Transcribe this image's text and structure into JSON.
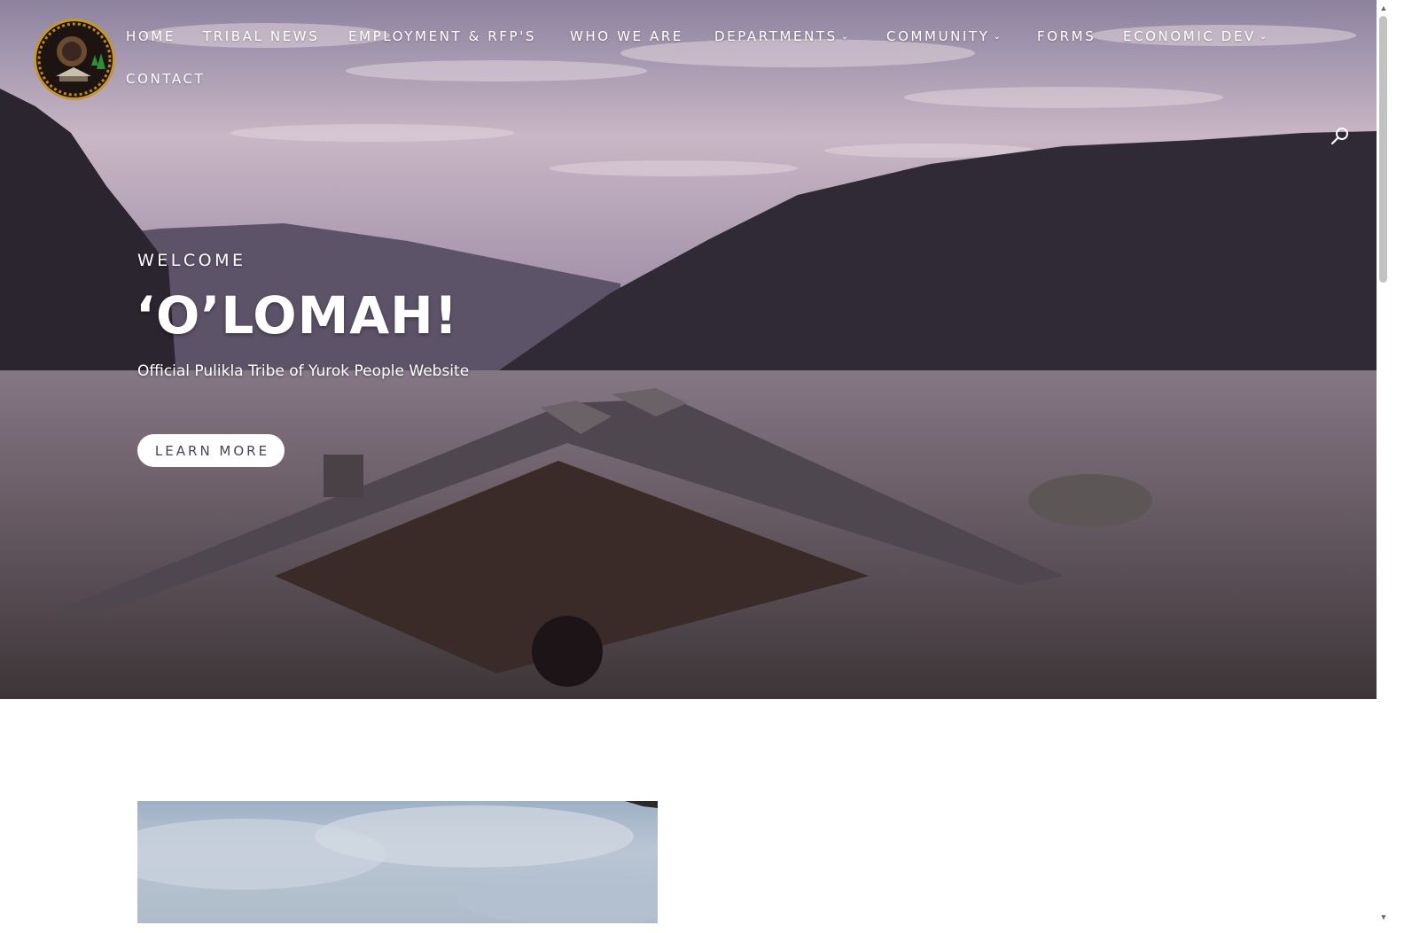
{
  "nav": {
    "items": [
      {
        "label": "HOME",
        "has_submenu": false
      },
      {
        "label": "TRIBAL NEWS",
        "has_submenu": false
      },
      {
        "label": "EMPLOYMENT & RFP'S",
        "has_submenu": false
      },
      {
        "label": "WHO WE ARE",
        "has_submenu": false
      },
      {
        "label": "DEPARTMENTS",
        "has_submenu": true
      },
      {
        "label": "COMMUNITY",
        "has_submenu": true
      },
      {
        "label": "FORMS",
        "has_submenu": false
      },
      {
        "label": "ECONOMIC DEV",
        "has_submenu": true
      },
      {
        "label": "CONTACT",
        "has_submenu": false
      }
    ],
    "submenu_icon": "chevron-down-icon",
    "search_icon": "search-icon"
  },
  "hero": {
    "kicker": "WELCOME",
    "title": "‘O’LOMAH!",
    "subtitle": "Official Pulikla Tribe of Yurok People Website",
    "cta_label": "LEARN MORE"
  },
  "colors": {
    "text_on_hero": "#ffffff",
    "button_bg": "#ffffff",
    "button_text": "#4a4257",
    "page_bg": "#ffffff"
  }
}
